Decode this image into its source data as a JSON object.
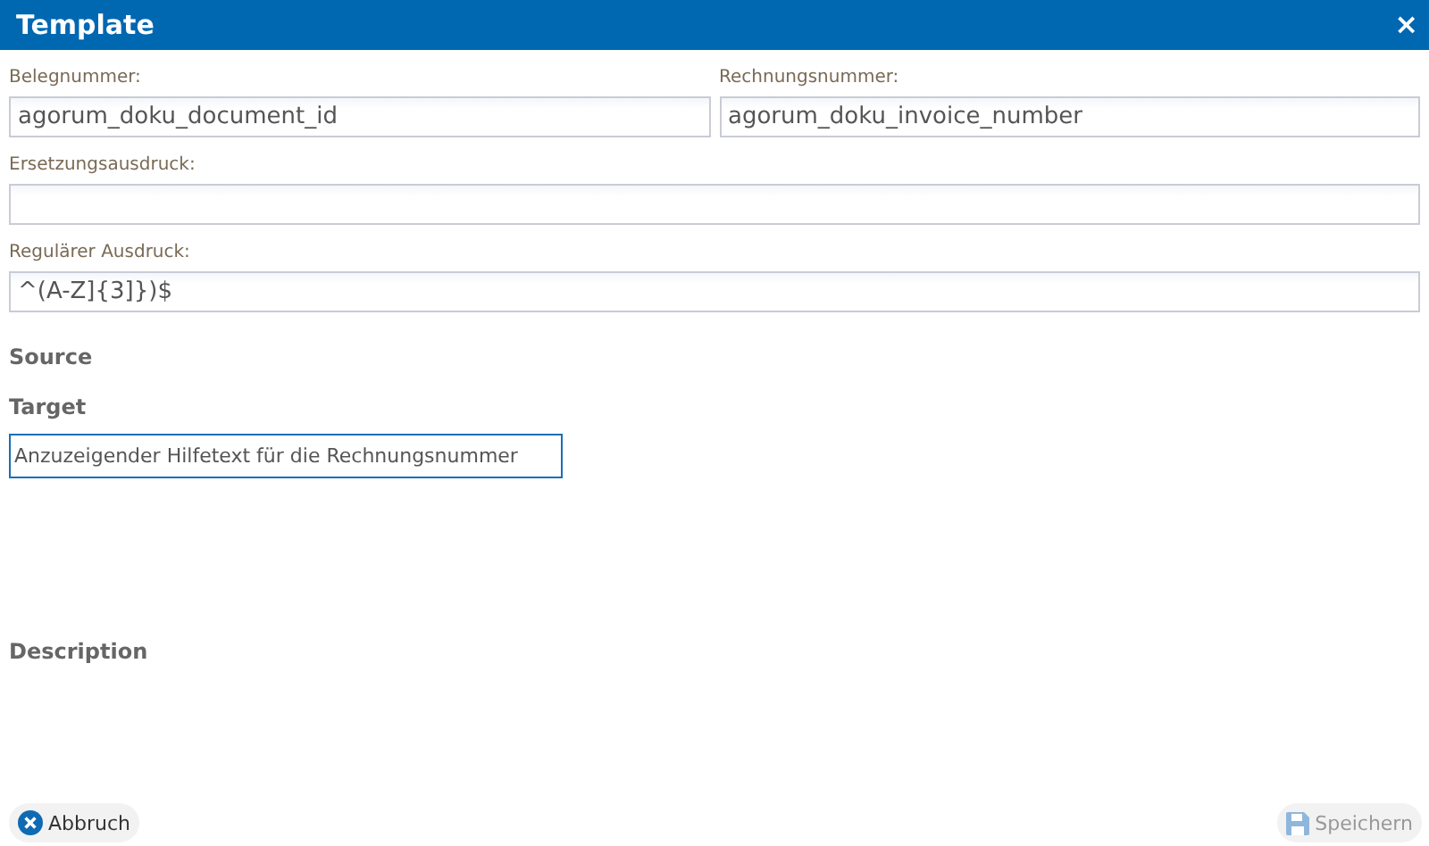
{
  "window": {
    "title": "Template",
    "close": "×"
  },
  "field_rows": [
    [
      {
        "label": "Belegnummer:",
        "value": "agorum_doku_document_id"
      },
      {
        "label": "Rechnungsnummer:",
        "value": "agorum_doku_invoice_number"
      }
    ],
    [
      {
        "label": "Ersetzungsausdruck:"
      }
    ],
    [
      {
        "label": "Regulärer Ausdruck:",
        "value": "^(A-Z]{3]})$"
      }
    ]
  ],
  "sections": [
    {
      "heading": "Source"
    },
    {
      "heading": "Target",
      "field": {
        "value": "Anzuzeigender Hilfetext für die Rechnungsnummer",
        "focused": true
      }
    },
    {
      "heading": "Description"
    }
  ],
  "buttons": [
    {
      "kind": "cancel",
      "label": "Abbruch",
      "disabled": false
    },
    {
      "kind": "save",
      "label": "Speichern",
      "disabled": true
    }
  ]
}
